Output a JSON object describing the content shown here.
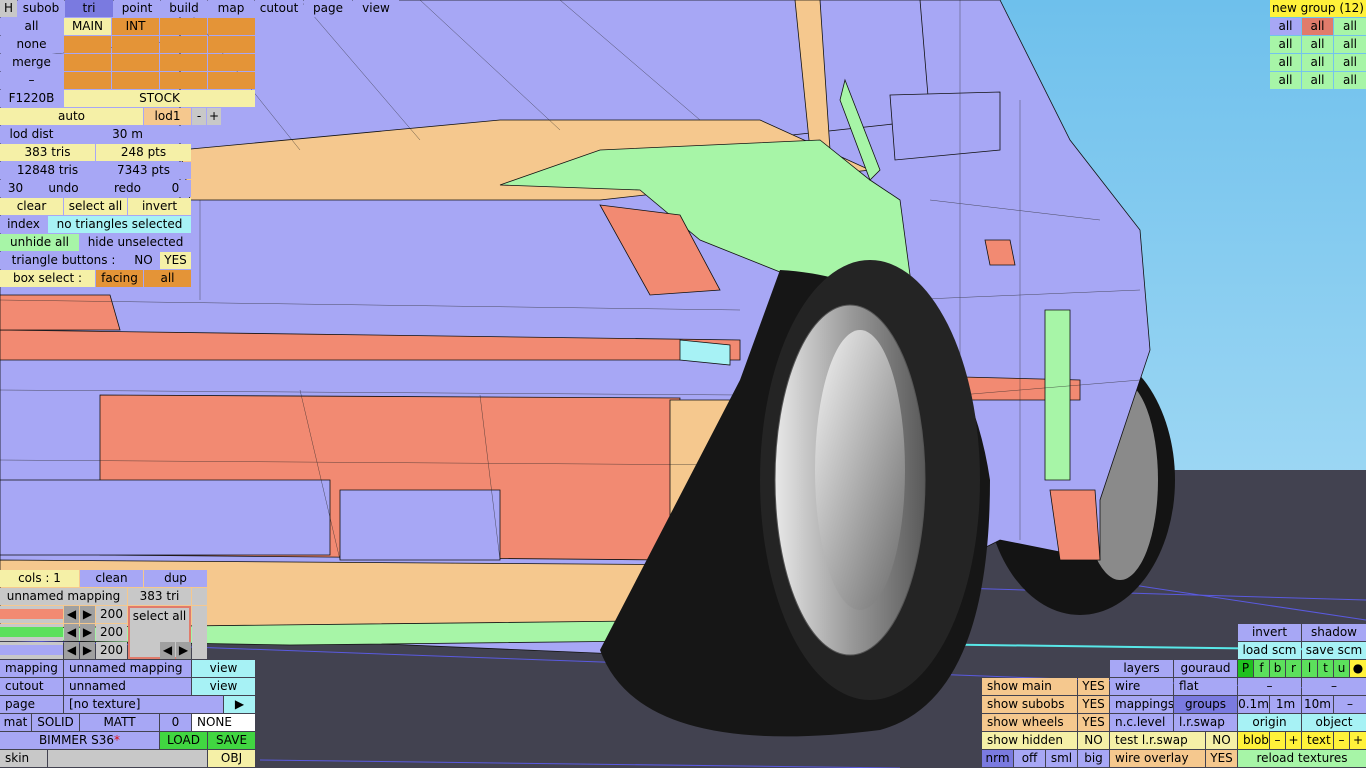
{
  "top_tabs": [
    "H",
    "subob",
    "tri",
    "point",
    "build",
    "map",
    "cutout",
    "page",
    "view"
  ],
  "selection": {
    "all": "all",
    "none": "none",
    "merge": "merge",
    "dash": "–",
    "main": "MAIN",
    "int": "INT"
  },
  "model": {
    "code": "F1220B",
    "variant": "STOCK"
  },
  "lod": {
    "auto": "auto",
    "level": "lod1",
    "minus": "-",
    "plus": "+",
    "dist_label": "lod dist",
    "dist_value": "30 m"
  },
  "stats": {
    "tris": "383 tris",
    "pts": "248 pts",
    "total_tris": "12848 tris",
    "total_pts": "7343 pts"
  },
  "history": {
    "count": "30",
    "undo": "undo",
    "redo": "redo",
    "redo_count": "0"
  },
  "tri_ops": {
    "clear": "clear",
    "select_all": "select all",
    "invert": "invert",
    "index": "index",
    "index_status": "no triangles selected",
    "unhide_all": "unhide all",
    "hide_unselected": "hide unselected",
    "tri_buttons": "triangle buttons :",
    "no": "NO",
    "yes": "YES",
    "box_select": "box select :",
    "facing": "facing",
    "all": "all"
  },
  "mapping_panel": {
    "cols": "cols : 1",
    "clean": "clean",
    "dup": "dup",
    "name": "unnamed mapping",
    "tri_count": "383 tri",
    "val1": "200",
    "val2": "200",
    "val3": "200",
    "select_all": "select all",
    "arrow_left": "◀",
    "arrow_right": "▶"
  },
  "bottom_left": {
    "mapping_label": "mapping",
    "mapping_value": "unnamed mapping",
    "mapping_view": "view",
    "cutout_label": "cutout",
    "cutout_value": "unnamed",
    "cutout_view": "view",
    "page_label": "page",
    "page_value": "[no texture]",
    "page_arrow": "▶",
    "mat_label": "mat",
    "solid": "SOLID",
    "matt": "MATT",
    "mat_num": "0",
    "mat_none": "NONE",
    "car_name": "BIMMER S36",
    "load": "LOAD",
    "save": "SAVE",
    "skin": "skin",
    "obj": "OBJ"
  },
  "groups": {
    "title": "new group (12)",
    "cells": [
      "all",
      "all",
      "all",
      "all",
      "all",
      "all",
      "all",
      "all",
      "all",
      "all",
      "all",
      "all"
    ]
  },
  "bottom_right": {
    "invert": "invert",
    "shadow": "shadow",
    "load_scm": "load scm",
    "save_scm": "save scm",
    "flags": [
      "P",
      "f",
      "b",
      "r",
      "l",
      "t",
      "u"
    ],
    "dot": "●",
    "dash1": "–",
    "dash2": "–",
    "layers": "layers",
    "gouraud": "gouraud",
    "show_main": "show main",
    "yes1": "YES",
    "wire": "wire",
    "flat": "flat",
    "show_subobs": "show subobs",
    "yes2": "YES",
    "mappings": "mappings",
    "groups": "groups",
    "dist1": "0.1m",
    "dist2": "1m",
    "dist3": "10m",
    "dash3": "–",
    "show_wheels": "show wheels",
    "yes3": "YES",
    "nc_level": "n.c.level",
    "lr_swap": "l.r.swap",
    "origin": "origin",
    "object": "object",
    "show_hidden": "show hidden",
    "no1": "NO",
    "test_lr": "test l.r.swap",
    "no2": "NO",
    "blob": "blob",
    "text": "text",
    "minus": "–",
    "plus": "+",
    "nrm": "nrm",
    "off": "off",
    "sml": "sml",
    "big": "big",
    "wire_overlay": "wire overlay",
    "yes4": "YES",
    "reload": "reload textures"
  },
  "colors": {
    "sky": "#8fd0f0",
    "ground": "#424250",
    "body_blue": "#a7a7f5",
    "body_green": "#a7f5a7",
    "body_salmon": "#f28a72",
    "body_peach": "#f5c88e"
  }
}
